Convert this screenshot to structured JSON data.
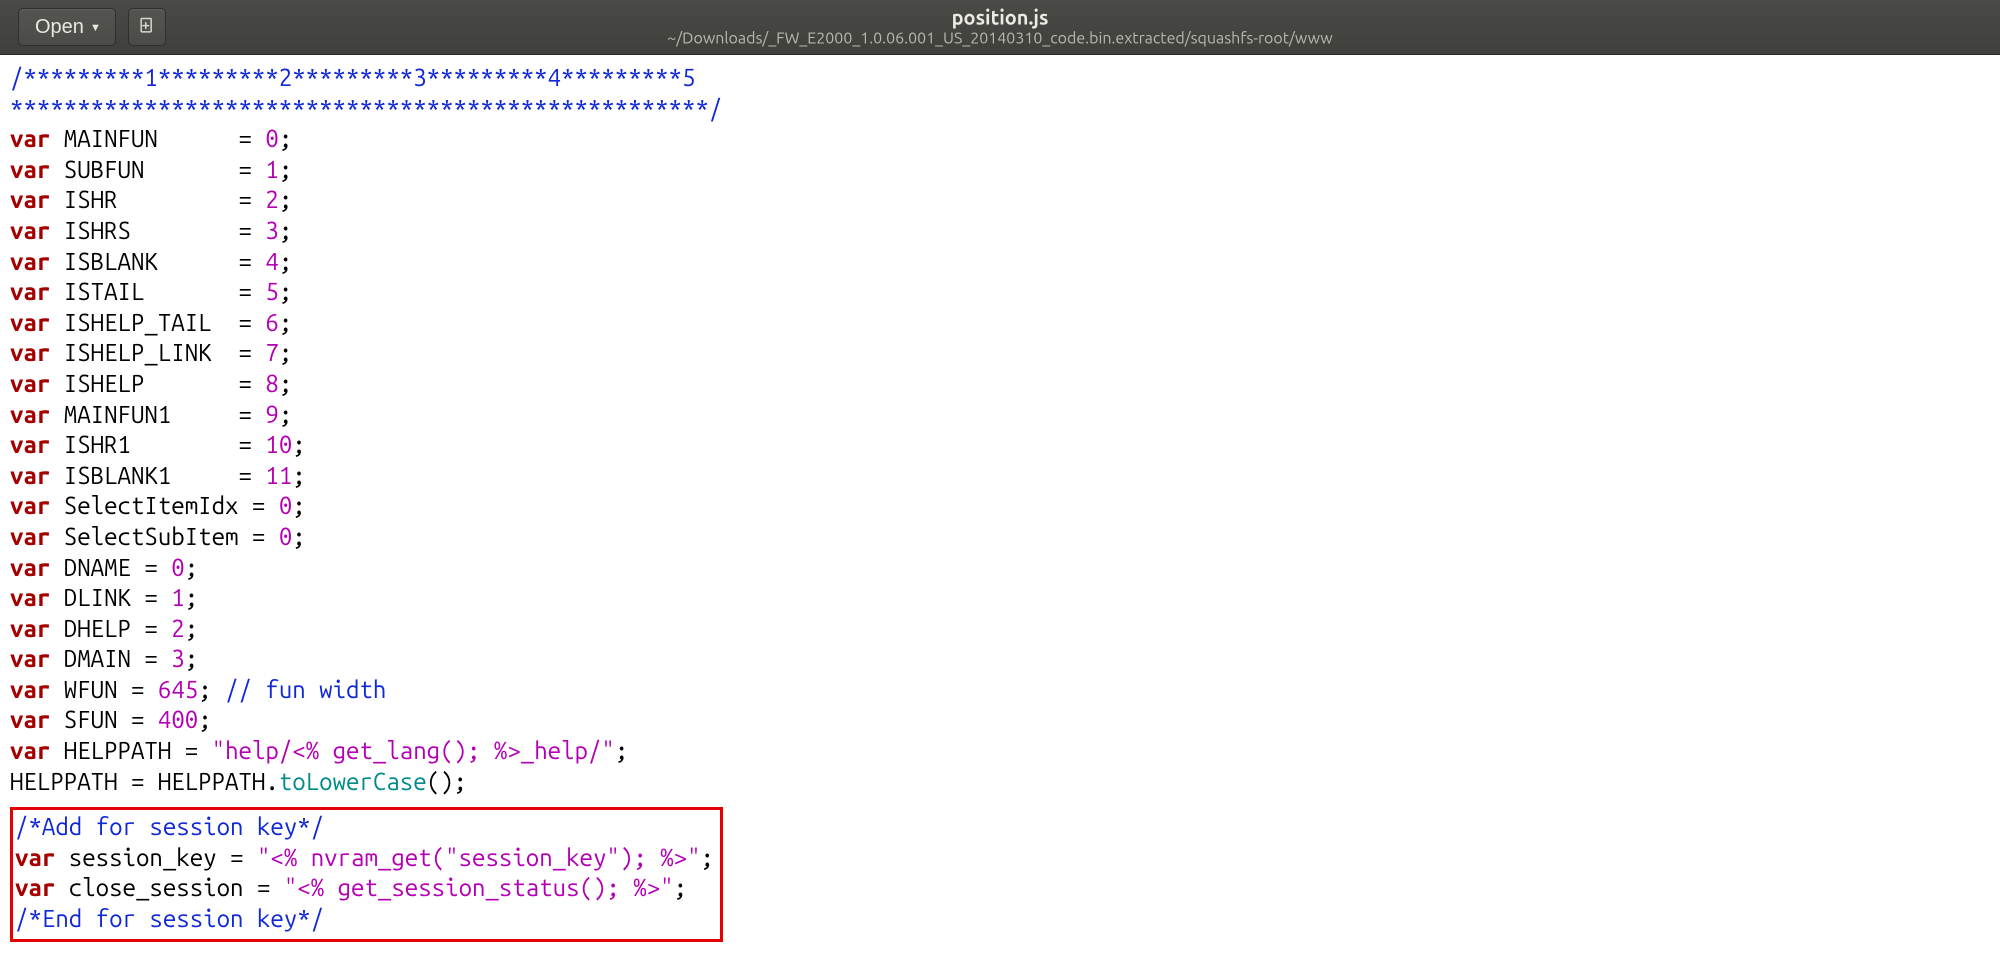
{
  "header": {
    "open_label": "Open",
    "filename": "position.js",
    "filepath": "~/Downloads/_FW_E2000_1.0.06.001_US_20140310_code.bin.extracted/squashfs-root/www"
  },
  "code": {
    "comment_ruler_line1": "/*********1*********2*********3*********4*********5",
    "comment_ruler_line2": "****************************************************/",
    "vars": [
      {
        "name": "MAINFUN",
        "pad": "     ",
        "value": "0"
      },
      {
        "name": "SUBFUN",
        "pad": "      ",
        "value": "1"
      },
      {
        "name": "ISHR",
        "pad": "        ",
        "value": "2"
      },
      {
        "name": "ISHRS",
        "pad": "       ",
        "value": "3"
      },
      {
        "name": "ISBLANK",
        "pad": "     ",
        "value": "4"
      },
      {
        "name": "ISTAIL",
        "pad": "      ",
        "value": "5"
      },
      {
        "name": "ISHELP_TAIL",
        "pad": " ",
        "value": "6"
      },
      {
        "name": "ISHELP_LINK",
        "pad": " ",
        "value": "7"
      },
      {
        "name": "ISHELP",
        "pad": "      ",
        "value": "8"
      },
      {
        "name": "MAINFUN1",
        "pad": "    ",
        "value": "9"
      },
      {
        "name": "ISHR1",
        "pad": "       ",
        "value": "10"
      },
      {
        "name": "ISBLANK1",
        "pad": "    ",
        "value": "11"
      }
    ],
    "vars2": [
      {
        "name": "SelectItemIdx",
        "value": "0"
      },
      {
        "name": "SelectSubItem",
        "value": "0"
      }
    ],
    "dvars": [
      {
        "name": "DNAME",
        "value": "0"
      },
      {
        "name": "DLINK",
        "value": "1"
      },
      {
        "name": "DHELP",
        "value": "2"
      },
      {
        "name": "DMAIN",
        "value": "3"
      }
    ],
    "wfun": {
      "name": "WFUN",
      "value": "645",
      "trail_comment": "// fun width"
    },
    "sfun": {
      "name": "SFUN",
      "value": "400"
    },
    "helppath_decl": {
      "name": "HELPPATH",
      "string": "\"help/<% get_lang(); %>_help/\""
    },
    "helppath_assign_left": "HELPPATH = HELPPATH.",
    "helppath_assign_fn": "toLowerCase",
    "helppath_assign_right": "();",
    "session": {
      "add_comment": "/*Add for session key*/",
      "sk_name": "session_key",
      "sk_str_full_outer_open": "\"",
      "sk_str_left": "<% nvram_get(",
      "sk_str_arg": "\"session_key\"",
      "sk_str_right": "); %>",
      "sk_str_full_outer_close": "\"",
      "cs_name": "close_session",
      "cs_string": "\"<% get_session_status(); %>\"",
      "end_comment": "/*End for session key*/"
    }
  }
}
